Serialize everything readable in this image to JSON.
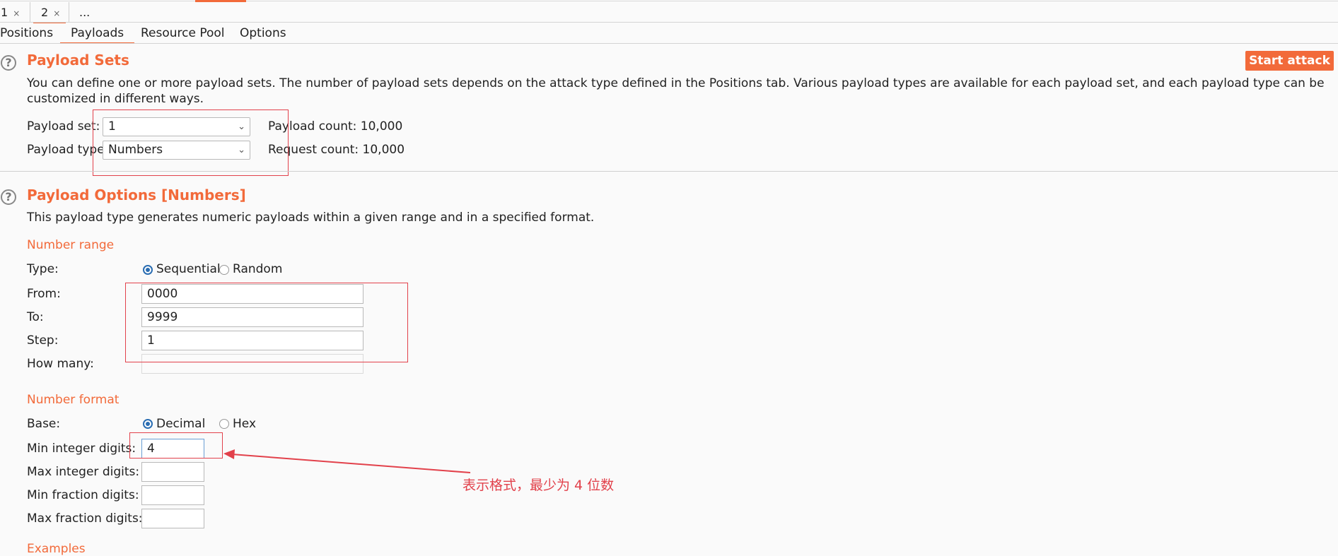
{
  "instance_tabs": [
    {
      "label": "1",
      "close": "×"
    },
    {
      "label": "2",
      "close": "×"
    },
    {
      "label": "..."
    }
  ],
  "sub_tabs": [
    "Positions",
    "Payloads",
    "Resource Pool",
    "Options"
  ],
  "payload_sets": {
    "help_icon": "?",
    "title": "Payload Sets",
    "description": "You can define one or more payload sets. The number of payload sets depends on the attack type defined in the Positions tab. Various payload types are available for each payload set, and each payload type can be customized in different ways.",
    "start_attack": "Start attack",
    "payload_set_label": "Payload set:",
    "payload_set_value": "1",
    "payload_type_label": "Payload type:",
    "payload_type_value": "Numbers",
    "payload_count": "Payload count: 10,000",
    "request_count": "Request count: 10,000"
  },
  "payload_options": {
    "help_icon": "?",
    "title": "Payload Options [Numbers]",
    "description": "This payload type generates numeric payloads within a given range and in a specified format.",
    "number_range": {
      "heading": "Number range",
      "type_label": "Type:",
      "type_options": [
        "Sequential",
        "Random"
      ],
      "type_selected": "Sequential",
      "from_label": "From:",
      "from_value": "0000",
      "to_label": "To:",
      "to_value": "9999",
      "step_label": "Step:",
      "step_value": "1",
      "how_many_label": "How many:",
      "how_many_value": ""
    },
    "number_format": {
      "heading": "Number format",
      "base_label": "Base:",
      "base_options": [
        "Decimal",
        "Hex"
      ],
      "base_selected": "Decimal",
      "min_integer_label": "Min integer digits:",
      "min_integer_value": "4",
      "max_integer_label": "Max integer digits:",
      "max_integer_value": "",
      "min_fraction_label": "Min fraction digits:",
      "min_fraction_value": "",
      "max_fraction_label": "Max fraction digits:",
      "max_fraction_value": ""
    },
    "examples_heading": "Examples"
  },
  "annotation": {
    "text": "表示格式，最少为 4 位数",
    "color": "#e2414b"
  },
  "colors": {
    "accent": "#f26a3a",
    "annotation_red": "#e2414b",
    "radio_blue": "#2a6db2"
  }
}
